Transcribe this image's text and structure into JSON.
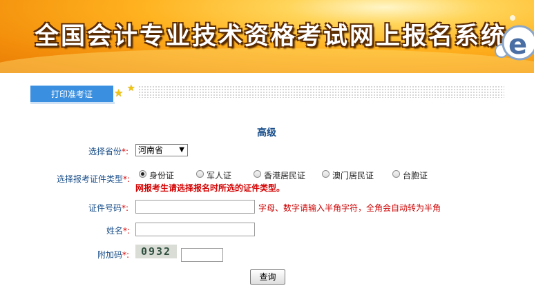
{
  "banner": {
    "title": "全国会计专业技术资格考试网上报名系统",
    "logo_letter": "e"
  },
  "tab": {
    "label": "打印准考证"
  },
  "form": {
    "section_title": "高级",
    "province": {
      "label": "选择省份",
      "required_mark": "*:",
      "value": "河南省"
    },
    "id_type": {
      "label": "选择报考证件类型",
      "required_mark": "*:",
      "options": [
        "身份证",
        "军人证",
        "香港居民证",
        "澳门居民证",
        "台胞证"
      ],
      "selected_index": 0,
      "warning": "网报考生请选择报名时所选的证件类型。"
    },
    "id_number": {
      "label": "证件号码",
      "required_mark": "*:",
      "value": "",
      "hint": "字母、数字请输入半角字符，全角会自动转为半角"
    },
    "name": {
      "label": "姓名",
      "required_mark": "*:",
      "value": ""
    },
    "captcha": {
      "label": "附加码",
      "required_mark": "*:",
      "code": "0932",
      "value": ""
    },
    "submit_label": "查询"
  },
  "colors": {
    "banner": "#f7a21b",
    "tab": "#3a8fe0",
    "label": "#1a4f8a",
    "warning": "#d40000"
  }
}
